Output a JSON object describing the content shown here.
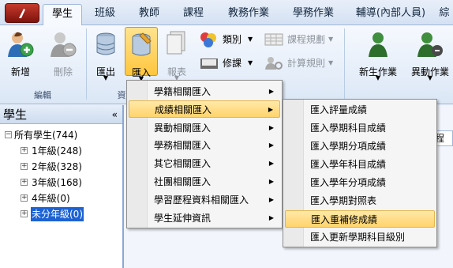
{
  "tabs": [
    {
      "label": "學生",
      "active": true
    },
    {
      "label": "班級",
      "active": false
    },
    {
      "label": "教師",
      "active": false
    },
    {
      "label": "課程",
      "active": false
    },
    {
      "label": "教務作業",
      "active": false
    },
    {
      "label": "學務作業",
      "active": false
    },
    {
      "label": "輔導(內部人員)",
      "active": false
    },
    {
      "label": "綜",
      "active": false
    }
  ],
  "ribbon": {
    "edit_group_label": "編輯",
    "add_label": "新增",
    "delete_label": "刪除",
    "export_label": "匯出",
    "import_label": "匯入",
    "report_label": "報表",
    "category_label": "類別",
    "schedule_label": "課程規劃",
    "repair_label": "修課",
    "calc_label": "計算規則",
    "new_student_label": "新生作業",
    "change_label": "異動作業",
    "partial_group_label": "資"
  },
  "left_panel": {
    "title": "學生",
    "collapse_icon": "«",
    "tree": {
      "root": "所有學生(744)",
      "children": [
        "1年級(248)",
        "2年級(328)",
        "3年級(168)",
        "4年級(0)",
        "未分年級(0)"
      ],
      "selected_index": 4
    }
  },
  "right_fragment": "課程",
  "import_menu": {
    "items": [
      {
        "label": "學籍相關匯入",
        "highlighted": false
      },
      {
        "label": "成績相關匯入",
        "highlighted": true
      },
      {
        "label": "異動相關匯入",
        "highlighted": false
      },
      {
        "label": "學務相關匯入",
        "highlighted": false
      },
      {
        "label": "其它相關匯入",
        "highlighted": false
      },
      {
        "label": "社團相關匯入",
        "highlighted": false
      },
      {
        "label": "學習歷程資料相關匯入",
        "highlighted": false
      },
      {
        "label": "學生延伸資訊",
        "highlighted": false
      }
    ]
  },
  "score_submenu": {
    "items": [
      {
        "label": "匯入評量成績",
        "highlighted": false
      },
      {
        "label": "匯入學期科目成績",
        "highlighted": false
      },
      {
        "label": "匯入學期分項成績",
        "highlighted": false
      },
      {
        "label": "匯入學年科目成績",
        "highlighted": false
      },
      {
        "label": "匯入學年分項成績",
        "highlighted": false
      },
      {
        "label": "匯入學期對照表",
        "highlighted": false
      },
      {
        "label": "匯入重補修成績",
        "highlighted": true
      },
      {
        "label": "匯入更新學期科目級別",
        "highlighted": false
      }
    ]
  },
  "colors": {
    "accent_highlight": "#ffd36b",
    "selection_blue": "#1c62d4",
    "app_button": "#a3241a"
  }
}
